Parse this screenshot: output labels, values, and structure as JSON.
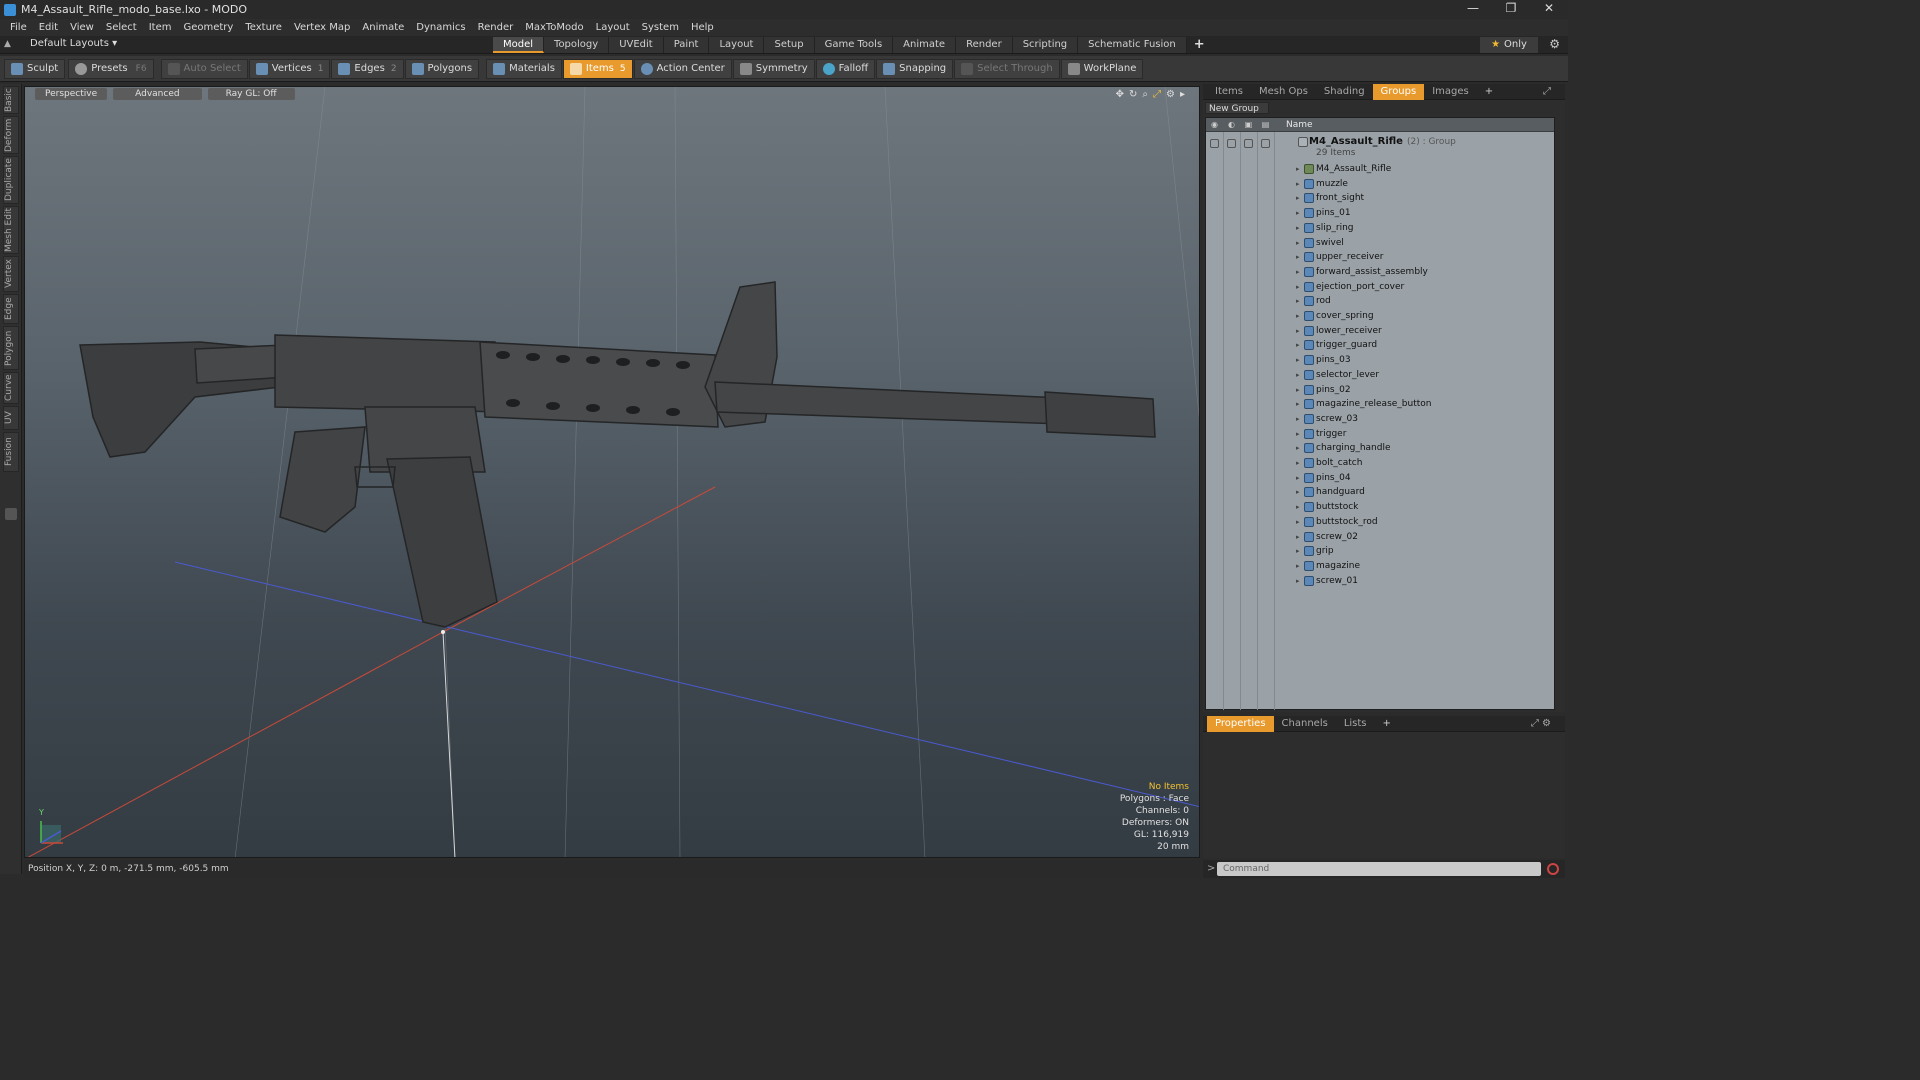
{
  "window": {
    "title": "M4_Assault_Rifle_modo_base.lxo - MODO",
    "controls": [
      "—",
      "❐",
      "✕"
    ]
  },
  "menu": [
    "File",
    "Edit",
    "View",
    "Select",
    "Item",
    "Geometry",
    "Texture",
    "Vertex Map",
    "Animate",
    "Dynamics",
    "Render",
    "MaxToModo",
    "Layout",
    "System",
    "Help"
  ],
  "layout": {
    "name": "Default Layouts ▾",
    "tabs": [
      {
        "label": "Model",
        "active": true
      },
      {
        "label": "Topology"
      },
      {
        "label": "UVEdit"
      },
      {
        "label": "Paint"
      },
      {
        "label": "Layout"
      },
      {
        "label": "Setup"
      },
      {
        "label": "Game Tools"
      },
      {
        "label": "Animate"
      },
      {
        "label": "Render"
      },
      {
        "label": "Scripting"
      },
      {
        "label": "Schematic Fusion"
      }
    ],
    "add_tab": "+",
    "only_label": "Only"
  },
  "toolbar": {
    "sculpt": "Sculpt",
    "presets": "Presets",
    "presets_key": "F6",
    "auto_select": "Auto Select",
    "vertices": "Vertices",
    "vertices_num": "1",
    "edges": "Edges",
    "edges_num": "2",
    "polygons": "Polygons",
    "materials": "Materials",
    "items": "Items",
    "items_num": "5",
    "action_center": "Action Center",
    "symmetry": "Symmetry",
    "falloff": "Falloff",
    "snapping": "Snapping",
    "select_through": "Select Through",
    "workplane": "WorkPlane"
  },
  "sidebar_tabs": [
    "Basic",
    "Deform",
    "Duplicate",
    "Mesh Edit",
    "Vertex",
    "Edge",
    "Polygon",
    "Curve",
    "UV",
    "Fusion"
  ],
  "viewport": {
    "view": "Perspective",
    "shading": "Advanced",
    "raygl": "Ray GL: Off",
    "info": {
      "no_items": "No Items",
      "polygons": "Polygons : Face",
      "channels": "Channels: 0",
      "deformers": "Deformers: ON",
      "gl": "GL: 116,919",
      "scale": "20 mm"
    },
    "axis_label": "Y"
  },
  "status": {
    "position": "Position X, Y, Z:  0 m, -271.5 mm, -605.5 mm"
  },
  "panel": {
    "tabs": [
      {
        "label": "Items"
      },
      {
        "label": "Mesh Ops"
      },
      {
        "label": "Shading"
      },
      {
        "label": "Groups",
        "active": true
      },
      {
        "label": "Images"
      }
    ],
    "add_tab": "+",
    "new_group": "New Group",
    "header_name": "Name",
    "group": {
      "name": "M4_Assault_Rifle",
      "meta": "(2) : Group",
      "count": "29 Items"
    },
    "items": [
      "M4_Assault_Rifle",
      "muzzle",
      "front_sight",
      "pins_01",
      "slip_ring",
      "swivel",
      "upper_receiver",
      "forward_assist_assembly",
      "ejection_port_cover",
      "rod",
      "cover_spring",
      "lower_receiver",
      "trigger_guard",
      "pins_03",
      "selector_lever",
      "pins_02",
      "magazine_release_button",
      "screw_03",
      "trigger",
      "charging_handle",
      "bolt_catch",
      "pins_04",
      "handguard",
      "buttstock",
      "buttstock_rod",
      "screw_02",
      "grip",
      "magazine",
      "screw_01"
    ]
  },
  "properties": {
    "tabs": [
      {
        "label": "Properties",
        "active": true
      },
      {
        "label": "Channels"
      },
      {
        "label": "Lists"
      }
    ],
    "add_tab": "+"
  },
  "command": {
    "placeholder": "Command"
  },
  "colors": {
    "accent": "#e89a2c",
    "viewport_top": "#6e767d",
    "viewport_bottom": "#343c43",
    "info_highlight": "#f2c232"
  }
}
